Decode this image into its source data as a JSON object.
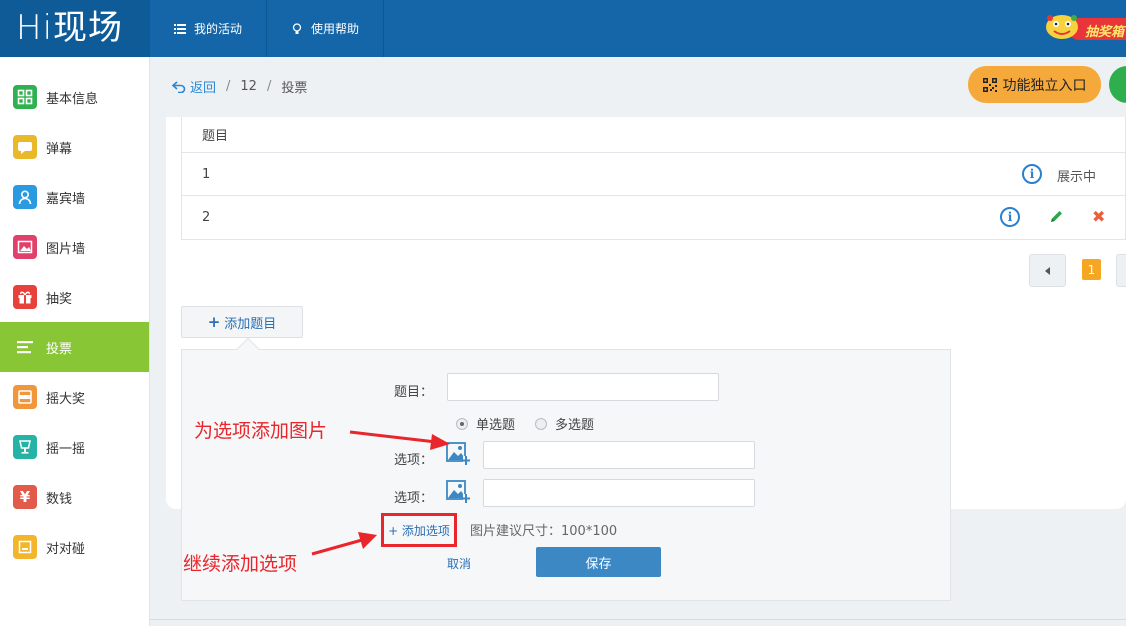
{
  "app": {
    "logo": "Hi现场"
  },
  "topnav": [
    {
      "label": "我的活动",
      "icon": "list-icon"
    },
    {
      "label": "使用帮助",
      "icon": "lightbulb-icon"
    }
  ],
  "promo": {
    "label": "抽奖箱"
  },
  "sidebar": {
    "items": [
      {
        "label": "基本信息",
        "icon": "grid-icon",
        "color": "#2fb14f"
      },
      {
        "label": "弹幕",
        "icon": "chat-bubble-icon",
        "color": "#e9b82b"
      },
      {
        "label": "嘉宾墙",
        "icon": "person-icon",
        "color": "#2a9be0"
      },
      {
        "label": "图片墙",
        "icon": "image-icon",
        "color": "#e0406a"
      },
      {
        "label": "抽奖",
        "icon": "gift-icon",
        "color": "#e8403a"
      },
      {
        "label": "投票",
        "icon": "vote-list-icon",
        "color": "#89c635",
        "active": true
      },
      {
        "label": "摇大奖",
        "icon": "slot-icon",
        "color": "#f1963a"
      },
      {
        "label": "摇一摇",
        "icon": "cup-icon",
        "color": "#25b3a6"
      },
      {
        "label": "数钱",
        "icon": "yen-icon",
        "color": "#e25a4a"
      },
      {
        "label": "对对碰",
        "icon": "match-icon",
        "color": "#f2b52b"
      }
    ]
  },
  "breadcrumb": {
    "back": "返回",
    "id": "12",
    "current": "投票"
  },
  "entry_button": {
    "label": "功能独立入口"
  },
  "table": {
    "header": "题目",
    "rows": [
      {
        "title": "1",
        "status": "展示中"
      },
      {
        "title": "2",
        "status": ""
      }
    ]
  },
  "pagination": {
    "current": "1"
  },
  "add_question": {
    "label": "添加题目"
  },
  "form": {
    "title_label": "题目：",
    "title_value": "",
    "radio_single": "单选题",
    "radio_multi": "多选题",
    "option_label": "选项：",
    "option1_value": "",
    "option2_value": "",
    "add_option": "+ 添加选项",
    "size_hint": "图片建议尺寸：100*100",
    "cancel": "取消",
    "save": "保存"
  },
  "annotations": {
    "image_tip": "为选项添加图片",
    "continue_tip": "继续添加选项"
  }
}
